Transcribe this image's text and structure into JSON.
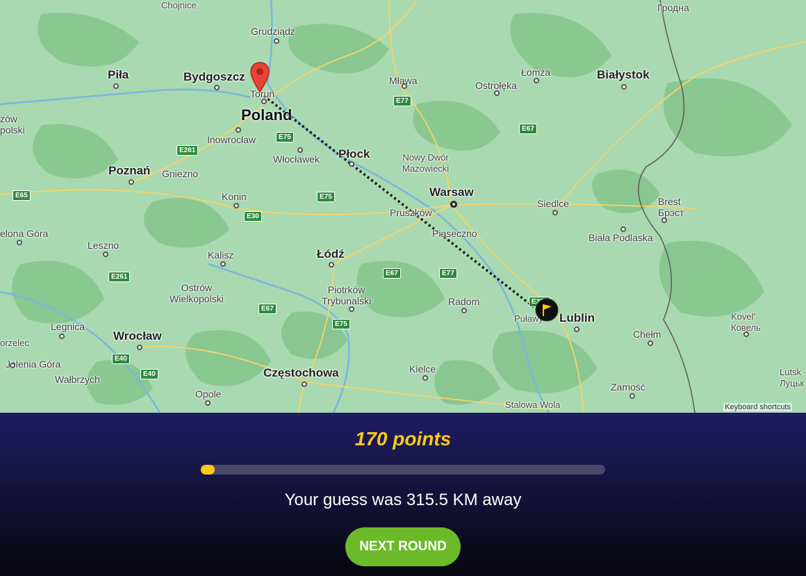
{
  "map": {
    "country_label": "Poland",
    "cities": [
      {
        "id": "chojnice",
        "name": "Chojnice"
      },
      {
        "id": "grudziadz",
        "name": "Grudziądz"
      },
      {
        "id": "hrodna",
        "name": "Гродна"
      },
      {
        "id": "pila",
        "name": "Piła"
      },
      {
        "id": "bydgoszcz",
        "name": "Bydgoszcz"
      },
      {
        "id": "torun",
        "name": "Toruń"
      },
      {
        "id": "mlawa",
        "name": "Mława"
      },
      {
        "id": "lomza",
        "name": "Łomża"
      },
      {
        "id": "ostroleka",
        "name": "Ostrołęka"
      },
      {
        "id": "bialystok",
        "name": "Białystok"
      },
      {
        "id": "inowroclaw",
        "name": "Inowrocław"
      },
      {
        "id": "wloclawek",
        "name": "Włocławek"
      },
      {
        "id": "plock",
        "name": "Płock"
      },
      {
        "id": "nowy-dwor",
        "name": "Nowy Dwór\nMazowiecki"
      },
      {
        "id": "poznan",
        "name": "Poznań"
      },
      {
        "id": "gniezno",
        "name": "Gniezno"
      },
      {
        "id": "konin",
        "name": "Konin"
      },
      {
        "id": "warsaw",
        "name": "Warsaw"
      },
      {
        "id": "pruszkow",
        "name": "Pruszków"
      },
      {
        "id": "piaseczno",
        "name": "Piaseczno"
      },
      {
        "id": "siedlce",
        "name": "Siedlce"
      },
      {
        "id": "brest",
        "name": "Brest\nБрэст"
      },
      {
        "id": "biala-podlaska",
        "name": "Biała Podlaska"
      },
      {
        "id": "zielona-gora",
        "name": "elona Góra"
      },
      {
        "id": "leszno",
        "name": "Leszno"
      },
      {
        "id": "kalisz",
        "name": "Kalisz"
      },
      {
        "id": "lodz",
        "name": "Łódź"
      },
      {
        "id": "ostrow",
        "name": "Ostrów\nWielkopolski"
      },
      {
        "id": "piotrkow",
        "name": "Piotrków\nTrybunalski"
      },
      {
        "id": "radom",
        "name": "Radom"
      },
      {
        "id": "pulawy",
        "name": "Puławy"
      },
      {
        "id": "lublin",
        "name": "Lublin"
      },
      {
        "id": "kovel",
        "name": "Kovel'\nКовель"
      },
      {
        "id": "legnica",
        "name": "Legnica"
      },
      {
        "id": "wroclaw",
        "name": "Wrocław"
      },
      {
        "id": "chelm",
        "name": "Chełm"
      },
      {
        "id": "zgorzelec",
        "name": "orzelec"
      },
      {
        "id": "jelenia-gora",
        "name": "Jelenia Góra"
      },
      {
        "id": "walbrzych",
        "name": "Wałbrzych"
      },
      {
        "id": "czestochowa",
        "name": "Częstochowa"
      },
      {
        "id": "kielce",
        "name": "Kielce"
      },
      {
        "id": "zamosc",
        "name": "Zamość"
      },
      {
        "id": "lutsk",
        "name": "Lutsk\nЛуцьк"
      },
      {
        "id": "opole",
        "name": "Opole"
      },
      {
        "id": "stalowa-wola",
        "name": "Stalowa Wola"
      },
      {
        "id": "zow",
        "name": "zów\npolski"
      }
    ],
    "roads": [
      "E77",
      "E67",
      "E261",
      "E75",
      "E65",
      "E30",
      "E75",
      "E67",
      "E261",
      "E77",
      "E67",
      "E75",
      "E40",
      "E40",
      "E372"
    ],
    "keyboard_shortcuts": "Keyboard shortcuts",
    "guess_marker": "red-pin-icon",
    "actual_marker": "flag-icon"
  },
  "result": {
    "points_text": "170 points",
    "points": 170,
    "progress_fraction": 0.034,
    "distance_text": "Your guess was 315.5 KM away",
    "next_button_label": "NEXT ROUND"
  },
  "colors": {
    "accent_yellow": "#fbc916",
    "button_green": "#6cb92a",
    "panel_top": "#1e1c63",
    "panel_bottom": "#07070e"
  }
}
